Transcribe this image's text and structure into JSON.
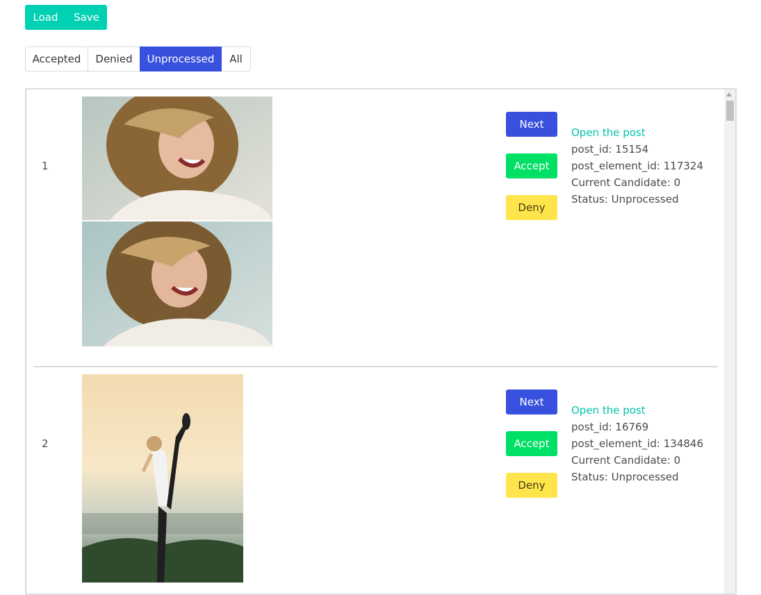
{
  "toolbar": {
    "load_label": "Load",
    "save_label": "Save"
  },
  "filters": [
    {
      "label": "Accepted",
      "active": false
    },
    {
      "label": "Denied",
      "active": false
    },
    {
      "label": "Unprocessed",
      "active": true
    },
    {
      "label": "All",
      "active": false
    }
  ],
  "items": [
    {
      "index": "1",
      "images": [
        "woman-laughing-curly-hair",
        "woman-laughing-curly-hair-crop"
      ],
      "next_label": "Next",
      "accept_label": "Accept",
      "deny_label": "Deny",
      "link_label": "Open the post",
      "post_id": "post_id: 15154",
      "post_element_id": "post_element_id: 117324",
      "current_candidate": "Current Candidate: 0",
      "status": "Status: Unprocessed"
    },
    {
      "index": "2",
      "images": [
        "woman-yoga-standing-split-sunset"
      ],
      "next_label": "Next",
      "accept_label": "Accept",
      "deny_label": "Deny",
      "link_label": "Open the post",
      "post_id": "post_id: 16769",
      "post_element_id": "post_element_id: 134846",
      "current_candidate": "Current Candidate: 0",
      "status": "Status: Unprocessed"
    }
  ],
  "colors": {
    "primary": "#00d1b2",
    "link": "#3850de",
    "success": "#00e064",
    "warning": "#ffe54c",
    "link_text": "#00c4a7"
  }
}
